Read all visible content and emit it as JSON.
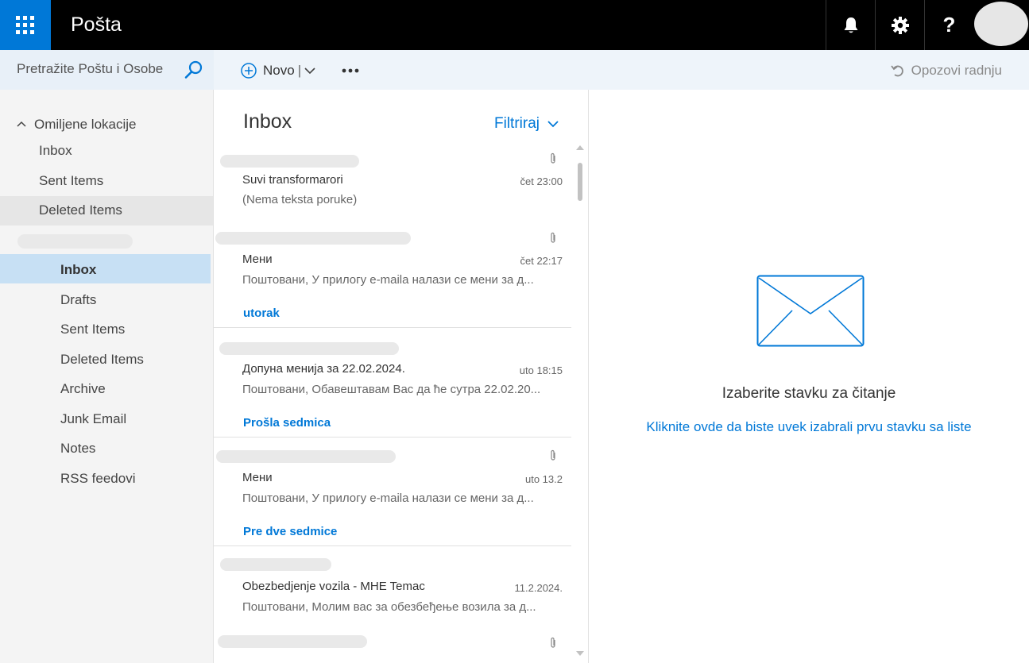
{
  "app": {
    "title": "Pošta"
  },
  "topbar": {
    "icons": [
      "app-launcher-icon",
      "bell-icon",
      "gear-icon",
      "help-icon"
    ],
    "help_label": "?"
  },
  "search": {
    "placeholder": "Pretražite Poštu i Osobe"
  },
  "commands": {
    "new_label": "Novo",
    "undo_label": "Opozovi radnju"
  },
  "nav": {
    "favorites_header": "Omiljene lokacije",
    "favorites": [
      "Inbox",
      "Sent Items",
      "Deleted Items"
    ],
    "folders": [
      "Inbox",
      "Drafts",
      "Sent Items",
      "Deleted Items",
      "Archive",
      "Junk Email",
      "Notes",
      "RSS feedovi"
    ],
    "selected_folder": "Inbox"
  },
  "list": {
    "title": "Inbox",
    "filter_label": "Filtriraj",
    "messages": [
      {
        "subject": "Suvi transformarori",
        "time": "čet 23:00",
        "preview": "(Nema teksta poruke)",
        "attachment": true
      },
      {
        "subject": "Мени",
        "time": "čet 22:17",
        "preview": "Поштовани, У прилогу e-maila налази се мени за д...",
        "attachment": true
      },
      {
        "subject": "Допуна менија за 22.02.2024.",
        "time": "uto 18:15",
        "preview": "Поштовани, Обавештавам Вас да ће сутра 22.02.20...",
        "attachment": false
      },
      {
        "subject": "Мени",
        "time": "uto 13.2",
        "preview": "Поштовани, У прилогу e-maila налази се мени за д...",
        "attachment": true
      },
      {
        "subject": "Obezbedjenje vozila - MHE Temac",
        "time": "11.2.2024.",
        "preview": "Поштовани, Молим вас за обезбеђење возила за д...",
        "attachment": false
      }
    ],
    "groups": [
      "utorak",
      "Prošla sedmica",
      "Pre dve sedmice"
    ]
  },
  "reading": {
    "title": "Izaberite stavku za čitanje",
    "link": "Kliknite ovde da biste uvek izabrali prvu stavku sa liste"
  },
  "colors": {
    "accent": "#0078d7",
    "topbar": "#000000",
    "selected": "#c7e0f4"
  }
}
